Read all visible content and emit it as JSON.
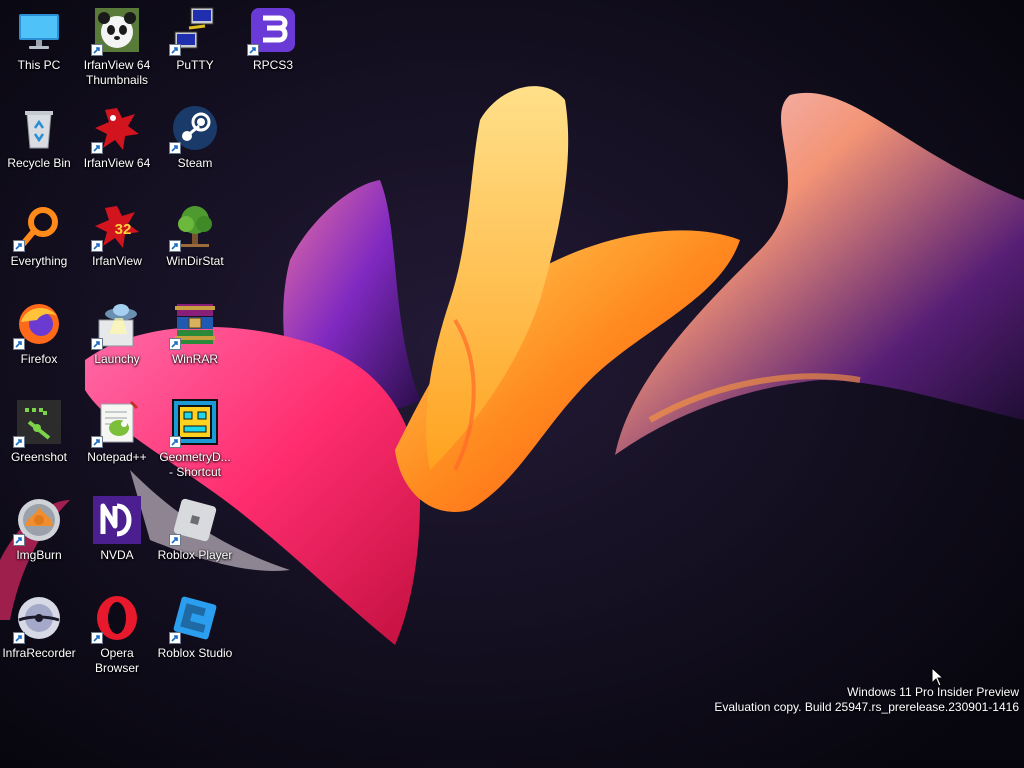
{
  "desktop": {
    "icons": {
      "this_pc": {
        "label": "This PC"
      },
      "recycle_bin": {
        "label": "Recycle Bin"
      },
      "everything": {
        "label": "Everything"
      },
      "firefox": {
        "label": "Firefox"
      },
      "greenshot": {
        "label": "Greenshot"
      },
      "imgburn": {
        "label": "ImgBurn"
      },
      "infrarecorder": {
        "label": "InfraRecorder"
      },
      "irfanview_thumbs": {
        "label": "IrfanView 64\nThumbnails"
      },
      "irfanview64": {
        "label": "IrfanView 64"
      },
      "irfanview": {
        "label": "IrfanView"
      },
      "launchy": {
        "label": "Launchy"
      },
      "notepadpp": {
        "label": "Notepad++"
      },
      "nvda": {
        "label": "NVDA"
      },
      "opera": {
        "label": "Opera\nBrowser"
      },
      "putty": {
        "label": "PuTTY"
      },
      "steam": {
        "label": "Steam"
      },
      "windirstat": {
        "label": "WinDirStat"
      },
      "winrar": {
        "label": "WinRAR"
      },
      "geometrydash": {
        "label": "GeometryD...\n- Shortcut"
      },
      "roblox_player": {
        "label": "Roblox Player"
      },
      "roblox_studio": {
        "label": "Roblox Studio"
      },
      "rpcs3": {
        "label": "RPCS3"
      }
    },
    "irfanview_badge": "32",
    "watermark": {
      "line1": "Windows 11 Pro Insider Preview",
      "line2": "Evaluation copy. Build 25947.rs_prerelease.230901-1416"
    }
  },
  "colors": {
    "background": "#0b0a16",
    "wallpaper_pink": "#ff2d6f",
    "wallpaper_orange": "#ff7a1a",
    "wallpaper_yellow": "#ffc44a"
  }
}
